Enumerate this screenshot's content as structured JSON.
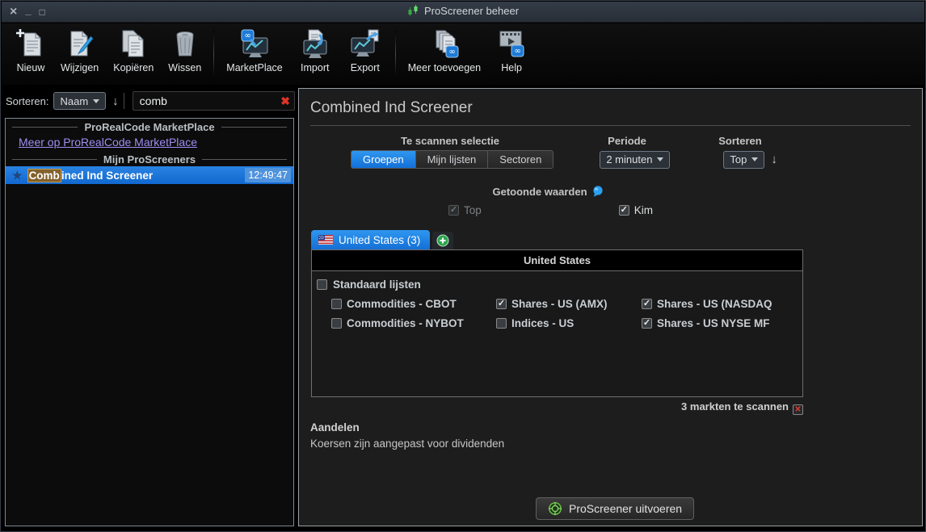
{
  "window": {
    "title": "ProScreener beheer",
    "controls": {
      "close": "×",
      "minimize": "_",
      "maximize": "□"
    }
  },
  "toolbar": {
    "items": [
      {
        "label": "Nieuw",
        "icon": "new-document-icon"
      },
      {
        "label": "Wijzigen",
        "icon": "edit-document-icon"
      },
      {
        "label": "Kopiëren",
        "icon": "copy-documents-icon"
      },
      {
        "label": "Wissen",
        "icon": "trash-icon"
      },
      {
        "label": "MarketPlace",
        "icon": "marketplace-monitor-icon"
      },
      {
        "label": "Import",
        "icon": "import-icon"
      },
      {
        "label": "Export",
        "icon": "export-icon"
      },
      {
        "label": "Meer toevoegen",
        "icon": "add-more-documents-icon"
      },
      {
        "label": "Help",
        "icon": "help-video-icon"
      }
    ]
  },
  "sidebar": {
    "sort_label": "Sorteren:",
    "sort_value": "Naam",
    "sort_direction_icon": "↓",
    "search": {
      "value": "comb",
      "clear_icon": "✖"
    },
    "marketplace_header": "ProRealCode MarketPlace",
    "marketplace_link": "Meer op ProRealCode MarketPlace",
    "my_screeners_header": "Mijn ProScreeners",
    "selected_item": {
      "name_highlight": "Comb",
      "name_rest": "ined Ind Screener",
      "time": "12:49:47"
    }
  },
  "main": {
    "title": "Combined Ind Screener",
    "scan_label": "Te scannen selectie",
    "tabs": [
      {
        "label": "Groepen",
        "active": true
      },
      {
        "label": "Mijn lijsten",
        "active": false
      },
      {
        "label": "Sectoren",
        "active": false
      }
    ],
    "periode_label": "Periode",
    "periode_value": "2 minuten",
    "sort_label": "Sorteren",
    "sort_value": "Top",
    "sort_direction_icon": "↓",
    "values_label": "Getoonde waarden",
    "value_checkboxes": [
      {
        "label": "Top",
        "checked": true,
        "disabled": true
      },
      {
        "label": "Kim",
        "checked": true,
        "disabled": false
      }
    ],
    "country_tab": "United States (3)",
    "table": {
      "header": "United States",
      "parent": {
        "label": "Standaard lijsten",
        "checked": false
      },
      "items": [
        {
          "label": "Commodities - CBOT",
          "checked": false
        },
        {
          "label": "Shares - US (AMX)",
          "checked": true
        },
        {
          "label": "Shares - US (NASDAQ",
          "checked": true
        },
        {
          "label": "Commodities - NYBOT",
          "checked": false
        },
        {
          "label": "Indices - US",
          "checked": false
        },
        {
          "label": "Shares - US NYSE MF",
          "checked": true
        }
      ]
    },
    "markets_note": "3 markten te scannen",
    "aandelen_title": "Aandelen",
    "aandelen_note": "Koersen zijn aangepast voor dividenden",
    "run_button": "ProScreener uitvoeren"
  },
  "colors": {
    "accent_blue": "#1e82ea",
    "selected_row_blue": "#1570d8",
    "link_purple": "#a08df2",
    "highlight_tan": "#82612c",
    "alert_red": "#e03428",
    "plus_green": "#2ea44f"
  }
}
